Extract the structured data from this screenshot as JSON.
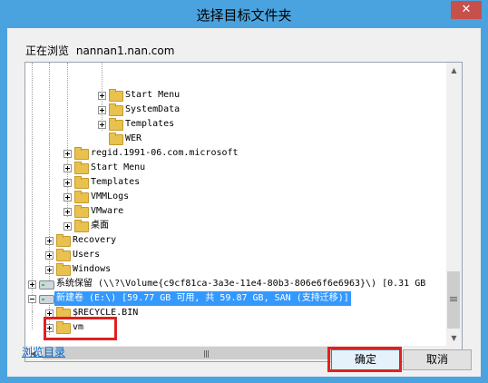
{
  "dialog": {
    "title": "选择目标文件夹",
    "close_symbol": "✕",
    "browsing_prefix": "正在浏览",
    "browsing_host": "nannan1.nan.com"
  },
  "tree": {
    "items": [
      {
        "label": "Start Menu",
        "expander": "plus"
      },
      {
        "label": "SystemData",
        "expander": "plus"
      },
      {
        "label": "Templates",
        "expander": "plus"
      },
      {
        "label": "WER",
        "expander": "none"
      },
      {
        "label": "regid.1991-06.com.microsoft",
        "expander": "plus"
      },
      {
        "label": "Start Menu",
        "expander": "plus"
      },
      {
        "label": "Templates",
        "expander": "plus"
      },
      {
        "label": "VMMLogs",
        "expander": "plus"
      },
      {
        "label": "VMware",
        "expander": "plus"
      },
      {
        "label": "桌面",
        "expander": "plus"
      },
      {
        "label": "Recovery",
        "expander": "plus"
      },
      {
        "label": "Users",
        "expander": "plus"
      },
      {
        "label": "Windows",
        "expander": "plus"
      },
      {
        "label": "系统保留 (\\\\?\\Volume{c9cf81ca-3a3e-11e4-80b3-806e6f6e6963}\\) [0.31 GB",
        "expander": "plus"
      },
      {
        "label": "新建卷 (E:\\) [59.77 GB 可用, 共 59.87 GB, SAN (支持迁移)]",
        "expander": "minus"
      },
      {
        "label": "$RECYCLE.BIN",
        "expander": "plus"
      },
      {
        "label": "vm",
        "expander": "plus"
      }
    ]
  },
  "footer": {
    "browse_link": "浏览目录",
    "ok_label": "确定",
    "cancel_label": "取消"
  },
  "colors": {
    "title_bar": "#4aa3df",
    "selection": "#3399ff",
    "highlight_box": "#e02020",
    "close_button": "#c7504a"
  }
}
